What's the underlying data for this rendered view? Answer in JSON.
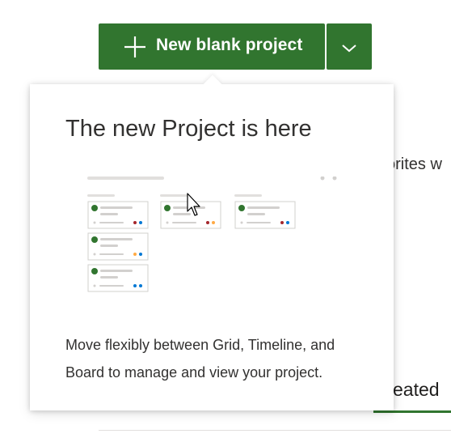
{
  "toolbar": {
    "new_button_label": "New blank project",
    "new_button_icon": "plus-icon",
    "dropdown_icon": "chevron-down-icon",
    "accent_color": "#31752f"
  },
  "callout": {
    "title": "The new Project is here",
    "body": "Move flexibly between Grid, Timeline, and Board to manage and view your project.",
    "illustration": "board-view-illustration"
  },
  "background": {
    "favorites_text_fragment": "orites w",
    "tab_label_fragment": "eated"
  },
  "cursor_icon": "mouse-pointer-icon"
}
